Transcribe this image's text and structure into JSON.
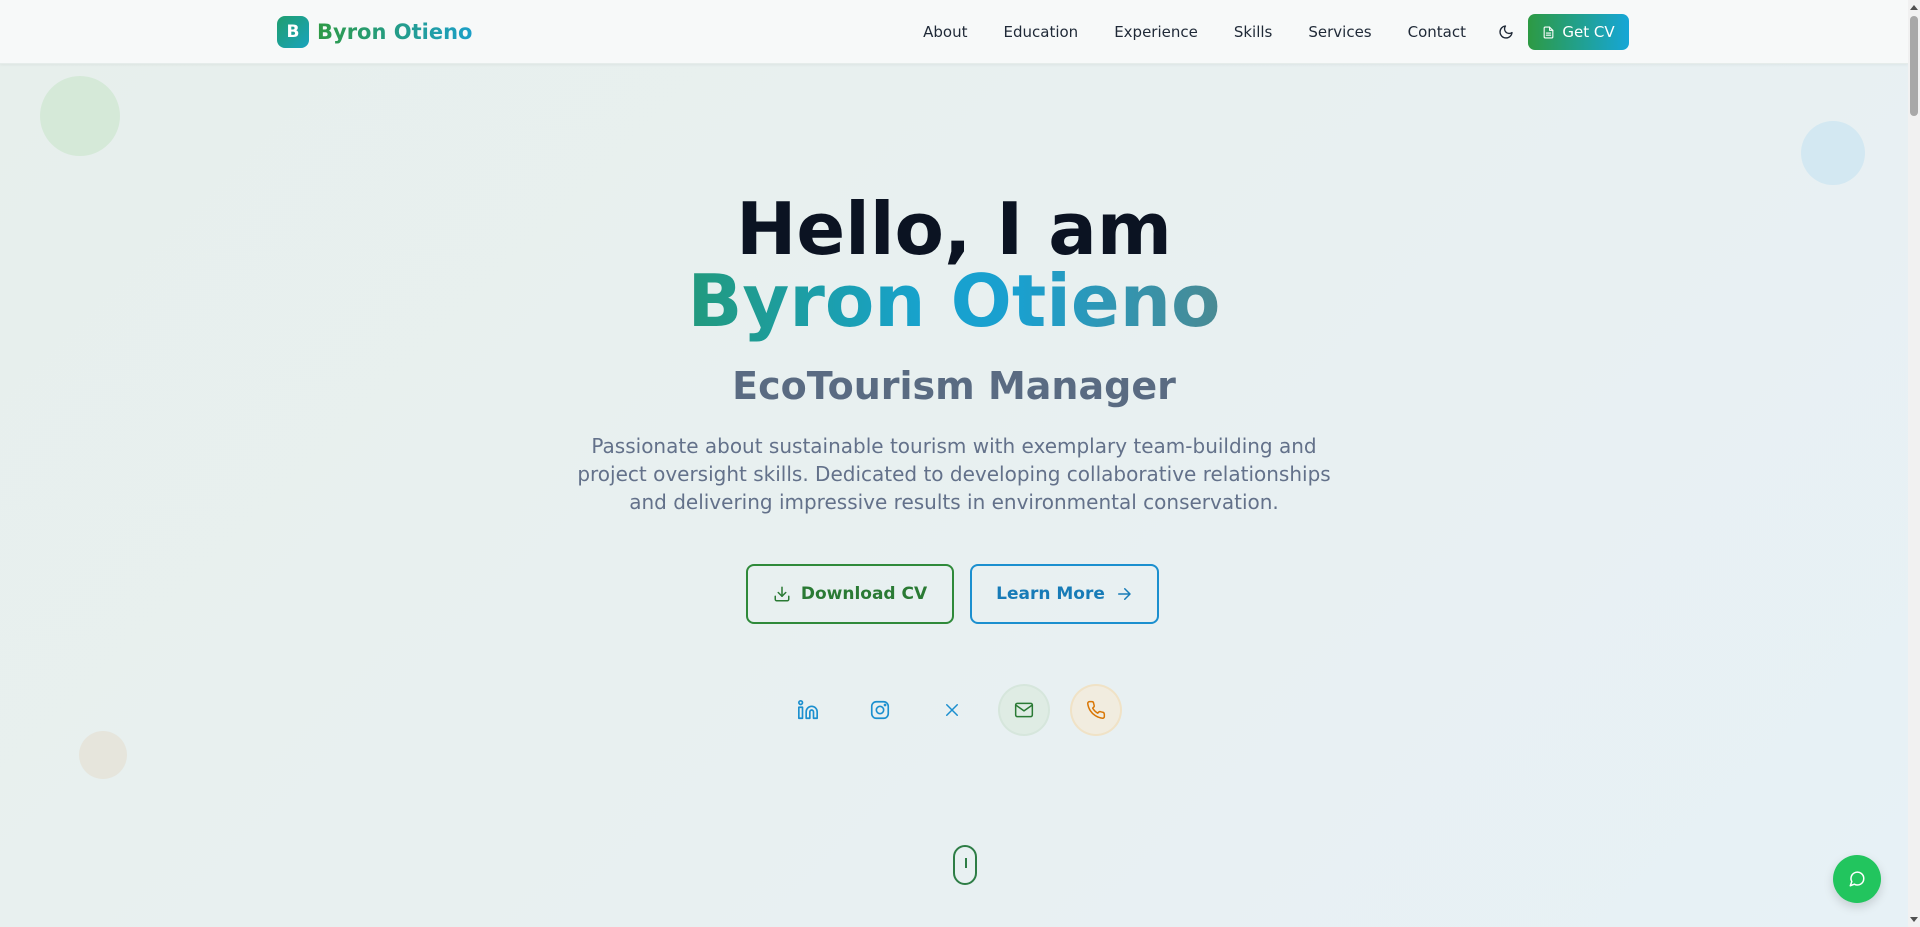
{
  "nav": {
    "brand_initial": "B",
    "brand_name": "Byron Otieno",
    "links": [
      "About",
      "Education",
      "Experience",
      "Skills",
      "Services",
      "Contact"
    ],
    "theme_toggle_icon": "moon-icon",
    "cv_button": "Get CV",
    "cv_button_icon": "document-icon"
  },
  "hero": {
    "greeting": "Hello, I am",
    "name": "Byron Otieno",
    "role": "EcoTourism Manager",
    "intro": "Passionate about sustainable tourism with exemplary team-building and project oversight skills. Dedicated to developing collaborative relationships and delivering impressive results in environmental conservation.",
    "download_button": "Download CV",
    "learn_button": "Learn More"
  },
  "socials": [
    "linkedin-icon",
    "instagram-icon",
    "x-icon",
    "mail-icon",
    "phone-icon"
  ],
  "chat_icon": "chat-icon",
  "colors": {
    "green": "#2e9a45",
    "blue": "#1b9fc8",
    "chat": "#22c55e"
  }
}
